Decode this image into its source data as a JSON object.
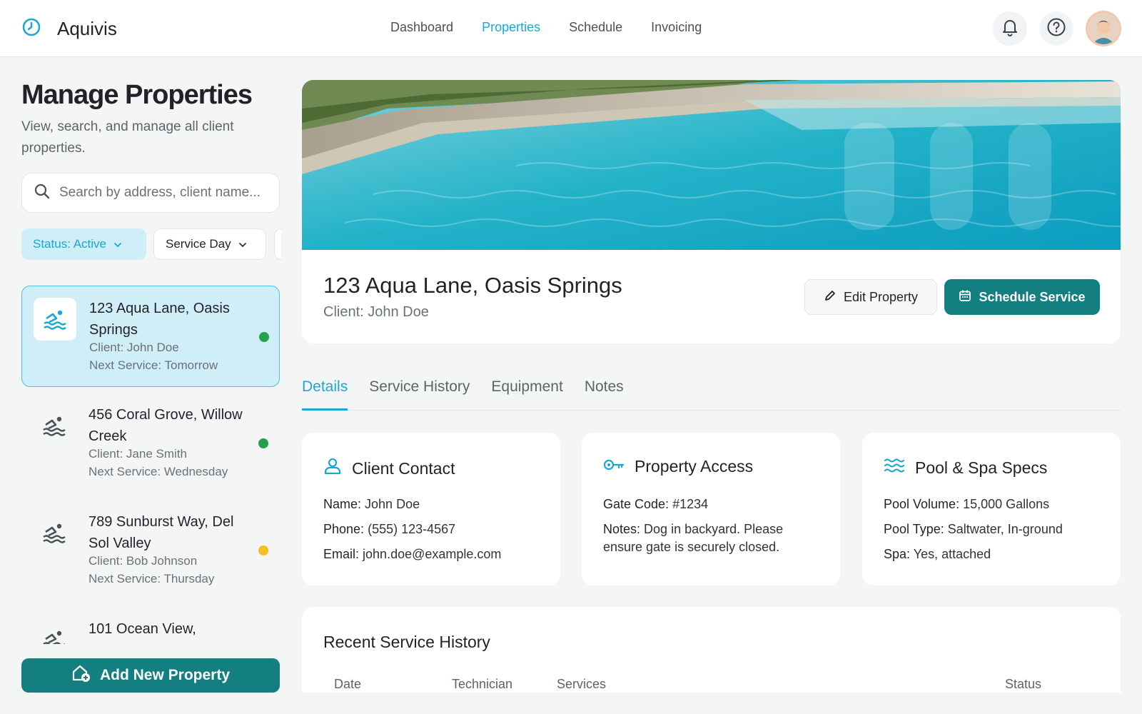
{
  "app": {
    "name": "Aquivis"
  },
  "nav": [
    {
      "label": "Dashboard",
      "active": false
    },
    {
      "label": "Properties",
      "active": true
    },
    {
      "label": "Schedule",
      "active": false
    },
    {
      "label": "Invoicing",
      "active": false
    }
  ],
  "icons": {
    "brand": "clock-logo-icon",
    "notifications": "bell-icon",
    "help": "question-circle-icon",
    "search": "search-icon",
    "property": "swimmer-icon",
    "edit": "pencil-icon",
    "schedule": "calendar-icon",
    "contact": "user-icon",
    "access": "key-icon",
    "specs": "waves-icon",
    "add": "house-plus-icon"
  },
  "colors": {
    "accent": "#1aa7d6",
    "primary_button": "#137f80",
    "status_active": "#23a24d",
    "status_pending": "#f5bf24"
  },
  "sidebar": {
    "title": "Manage Properties",
    "subtitle": "View, search, and manage all client properties.",
    "search_placeholder": "Search by address, client name...",
    "filters": [
      {
        "label": "Status: Active",
        "active": true
      },
      {
        "label": "Service Day",
        "active": false
      }
    ],
    "properties": [
      {
        "address": "123 Aqua Lane, Oasis Springs",
        "client": "Client: John Doe",
        "next_service": "Next Service: Tomorrow",
        "status_color": "#23a24d",
        "selected": true
      },
      {
        "address": "456 Coral Grove, Willow Creek",
        "client": "Client: Jane Smith",
        "next_service": "Next Service: Wednesday",
        "status_color": "#23a24d",
        "selected": false
      },
      {
        "address": "789 Sunburst Way, Del Sol Valley",
        "client": "Client: Bob Johnson",
        "next_service": "Next Service: Thursday",
        "status_color": "#f5bf24",
        "selected": false
      },
      {
        "address": "101 Ocean View,",
        "client": "",
        "next_service": "",
        "status_color": "",
        "selected": false
      }
    ],
    "add_button": "Add New Property"
  },
  "property": {
    "address": "123 Aqua Lane, Oasis Springs",
    "client": "Client: John Doe",
    "edit_label": "Edit Property",
    "schedule_label": "Schedule Service"
  },
  "tabs": [
    {
      "label": "Details",
      "active": true
    },
    {
      "label": "Service History",
      "active": false
    },
    {
      "label": "Equipment",
      "active": false
    },
    {
      "label": "Notes",
      "active": false
    }
  ],
  "cards": {
    "contact": {
      "title": "Client Contact",
      "name_label": "Name:",
      "name": "John Doe",
      "phone_label": "Phone:",
      "phone": "(555) 123-4567",
      "email_label": "Email:",
      "email": "john.doe@example.com"
    },
    "access": {
      "title": "Property Access",
      "gate_label": "Gate Code:",
      "gate": "#1234",
      "notes_label": "Notes:",
      "notes": "Dog in backyard. Please ensure gate is securely closed."
    },
    "specs": {
      "title": "Pool & Spa Specs",
      "volume_label": "Pool Volume:",
      "volume": "15,000 Gallons",
      "type_label": "Pool Type:",
      "type": "Saltwater, In-ground",
      "spa_label": "Spa:",
      "spa": "Yes, attached"
    }
  },
  "history": {
    "title": "Recent Service History",
    "columns": [
      "Date",
      "Technician",
      "Services",
      "Status"
    ]
  }
}
